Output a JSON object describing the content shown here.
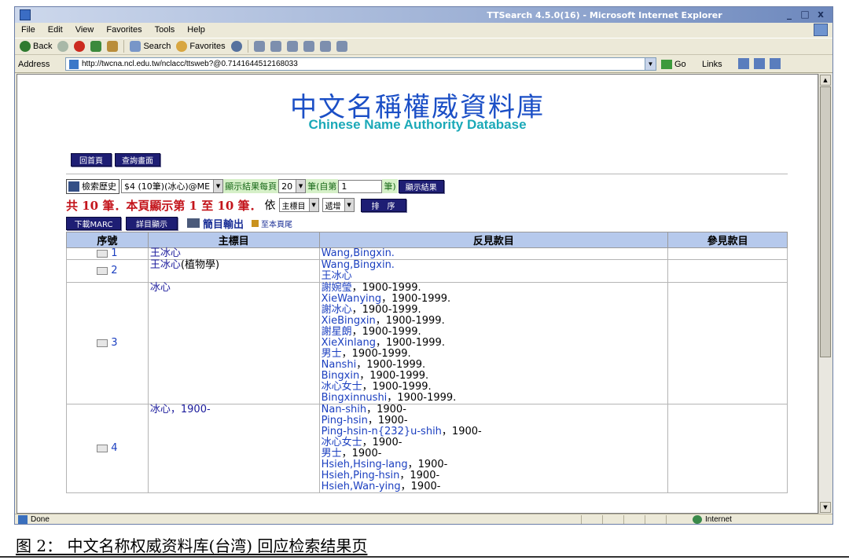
{
  "window": {
    "title": "TTSearch 4.5.0(16) - Microsoft Internet Explorer",
    "controls": [
      "_",
      "□",
      "x"
    ]
  },
  "menu": [
    "File",
    "Edit",
    "View",
    "Favorites",
    "Tools",
    "Help"
  ],
  "toolbar": {
    "back": "Back",
    "search": "Search",
    "favorites": "Favorites"
  },
  "address": {
    "label": "Address",
    "url": "http://twcna.ncl.edu.tw/nclacc/ttsweb?@0.7141644512168033",
    "go": "Go",
    "links": "Links"
  },
  "status": {
    "left": "Done",
    "zone": "Internet"
  },
  "page": {
    "title_cn": "中文名稱權威資料庫",
    "title_en": "Chinese Name Authority Database",
    "home_button": "回首頁",
    "query_button": "查詢畫面",
    "history_label": "檢索歷史",
    "history_value": "$4 (10筆)(冰心)@ME",
    "per_page_label": "顯示結果每頁",
    "per_page_value": "20",
    "from_label_a": "筆(自第",
    "from_value": "1",
    "from_label_b": "筆)",
    "show_button": "顯示結果",
    "count_text": "共 10 筆．本頁顯示第 1 至 10 筆．",
    "sort_by_label": "依",
    "sort_field": "主標目",
    "sort_order": "遞增",
    "sort_button": "排　序",
    "download_button": "下載MARC",
    "detail_button": "詳目顯示",
    "output_link": "簡目輸出",
    "end_link": "至本頁尾"
  },
  "table": {
    "headers": [
      "序號",
      "主標目",
      "反見款目",
      "參見款目"
    ],
    "rows": [
      {
        "num": "1",
        "heading": "王冰心",
        "heading_extra": "",
        "see_from": [
          {
            "name": "Wang,Bingxin.",
            "date": ""
          }
        ],
        "see_also": ""
      },
      {
        "num": "2",
        "heading": "王冰心",
        "heading_extra": "(植物學)",
        "see_from": [
          {
            "name": "Wang,Bingxin.",
            "date": ""
          },
          {
            "name": "王冰心",
            "date": ""
          }
        ],
        "see_also": ""
      },
      {
        "num": "3",
        "heading": "冰心",
        "heading_extra": "",
        "see_from": [
          {
            "name": "謝婉瑩",
            "date": "，1900-1999."
          },
          {
            "name": "XieWanying",
            "date": "，1900-1999."
          },
          {
            "name": "謝冰心",
            "date": "，1900-1999."
          },
          {
            "name": "XieBingxin",
            "date": "，1900-1999."
          },
          {
            "name": "謝星朗",
            "date": "，1900-1999."
          },
          {
            "name": "XieXinlang",
            "date": "，1900-1999."
          },
          {
            "name": "男士",
            "date": "，1900-1999."
          },
          {
            "name": "Nanshi",
            "date": "，1900-1999."
          },
          {
            "name": "Bingxin",
            "date": "，1900-1999."
          },
          {
            "name": "冰心女士",
            "date": "，1900-1999."
          },
          {
            "name": "Bingxinnushi",
            "date": "，1900-1999."
          }
        ],
        "see_also": ""
      },
      {
        "num": "4",
        "heading": "冰心",
        "heading_extra": "，1900-",
        "see_from": [
          {
            "name": "Nan-shih",
            "date": "，1900-"
          },
          {
            "name": "Ping-hsin",
            "date": "，1900-"
          },
          {
            "name": "Ping-hsin-n{232}u-shih",
            "date": "，1900-"
          },
          {
            "name": "冰心女士",
            "date": "，1900-"
          },
          {
            "name": "男士",
            "date": "，1900-"
          },
          {
            "name": "Hsieh,Hsing-lang",
            "date": "，1900-"
          },
          {
            "name": "Hsieh,Ping-hsin",
            "date": "，1900-"
          },
          {
            "name": "Hsieh,Wan-ying",
            "date": "，1900-"
          }
        ],
        "see_also": ""
      }
    ]
  },
  "caption": "图 2：  中文名称权威资料库(台湾) 回应检索结果页",
  "colors": {
    "title_cn": "#1b4fc6",
    "title_en": "#1ba9b8",
    "count_text": "#c3141b",
    "link": "#1b3fc0",
    "header_bg": "#b6c9ec",
    "button_bg": "#1e1e74"
  }
}
